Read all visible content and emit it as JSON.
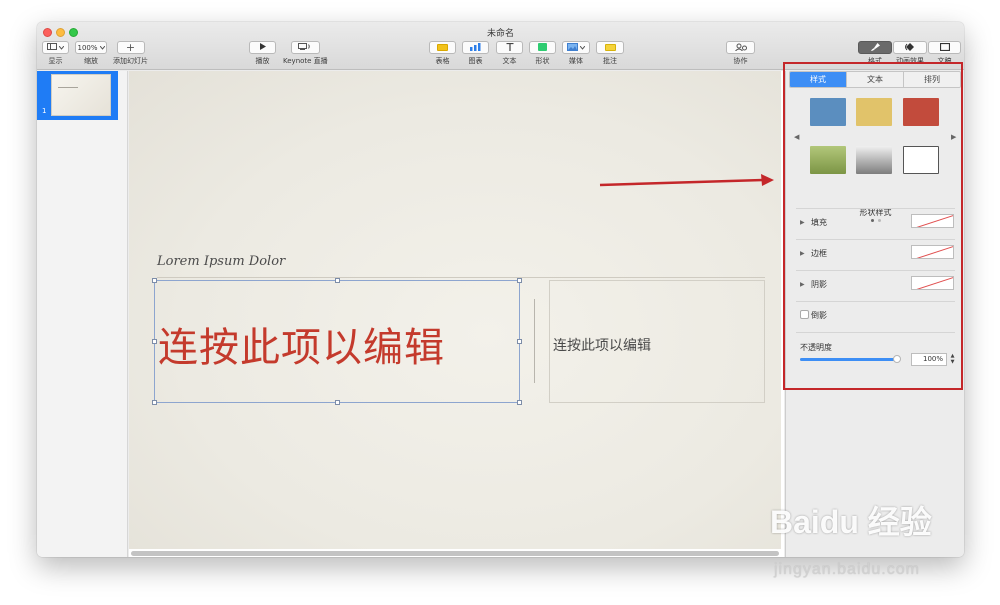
{
  "window": {
    "title": "未命名"
  },
  "toolbar": {
    "view_label": "显示",
    "zoom_value": "100%",
    "zoom_label": "缩放",
    "add_slide_label": "添加幻灯片",
    "play_label": "播放",
    "keynote_live_label": "Keynote 直播",
    "table_label": "表格",
    "chart_label": "图表",
    "text_label": "文本",
    "shape_label": "形状",
    "media_label": "媒体",
    "comment_label": "批注",
    "collaborate_label": "协作",
    "format_label": "格式",
    "animate_label": "动画效果",
    "document_label": "文稿"
  },
  "navigator": {
    "slides": [
      {
        "number": "1"
      }
    ]
  },
  "slide": {
    "title": "Lorem Ipsum Dolor",
    "main_text": "连按此项以编辑",
    "side_text": "连按此项以编辑",
    "main_text_color": "#c43a2c"
  },
  "inspector": {
    "tabs": [
      "样式",
      "文本",
      "排列"
    ],
    "active_tab": "样式",
    "shape_styles_label": "形状样式",
    "swatches": [
      "#5b8ebf",
      "#e1c36a",
      "#c24b3c",
      "#94ad5f",
      "#9b9b9b",
      "#ffffff"
    ],
    "fill_label": "填充",
    "border_label": "边框",
    "shadow_label": "阴影",
    "reflection_label": "倒影",
    "opacity_label": "不透明度",
    "opacity_value": "100%",
    "opacity_fraction": 1.0
  },
  "accent_color": "#3d8ef5",
  "annotation_color": "#c4272a",
  "watermark": {
    "logo": "Baidu 经验",
    "url": "jingyan.baidu.com"
  }
}
